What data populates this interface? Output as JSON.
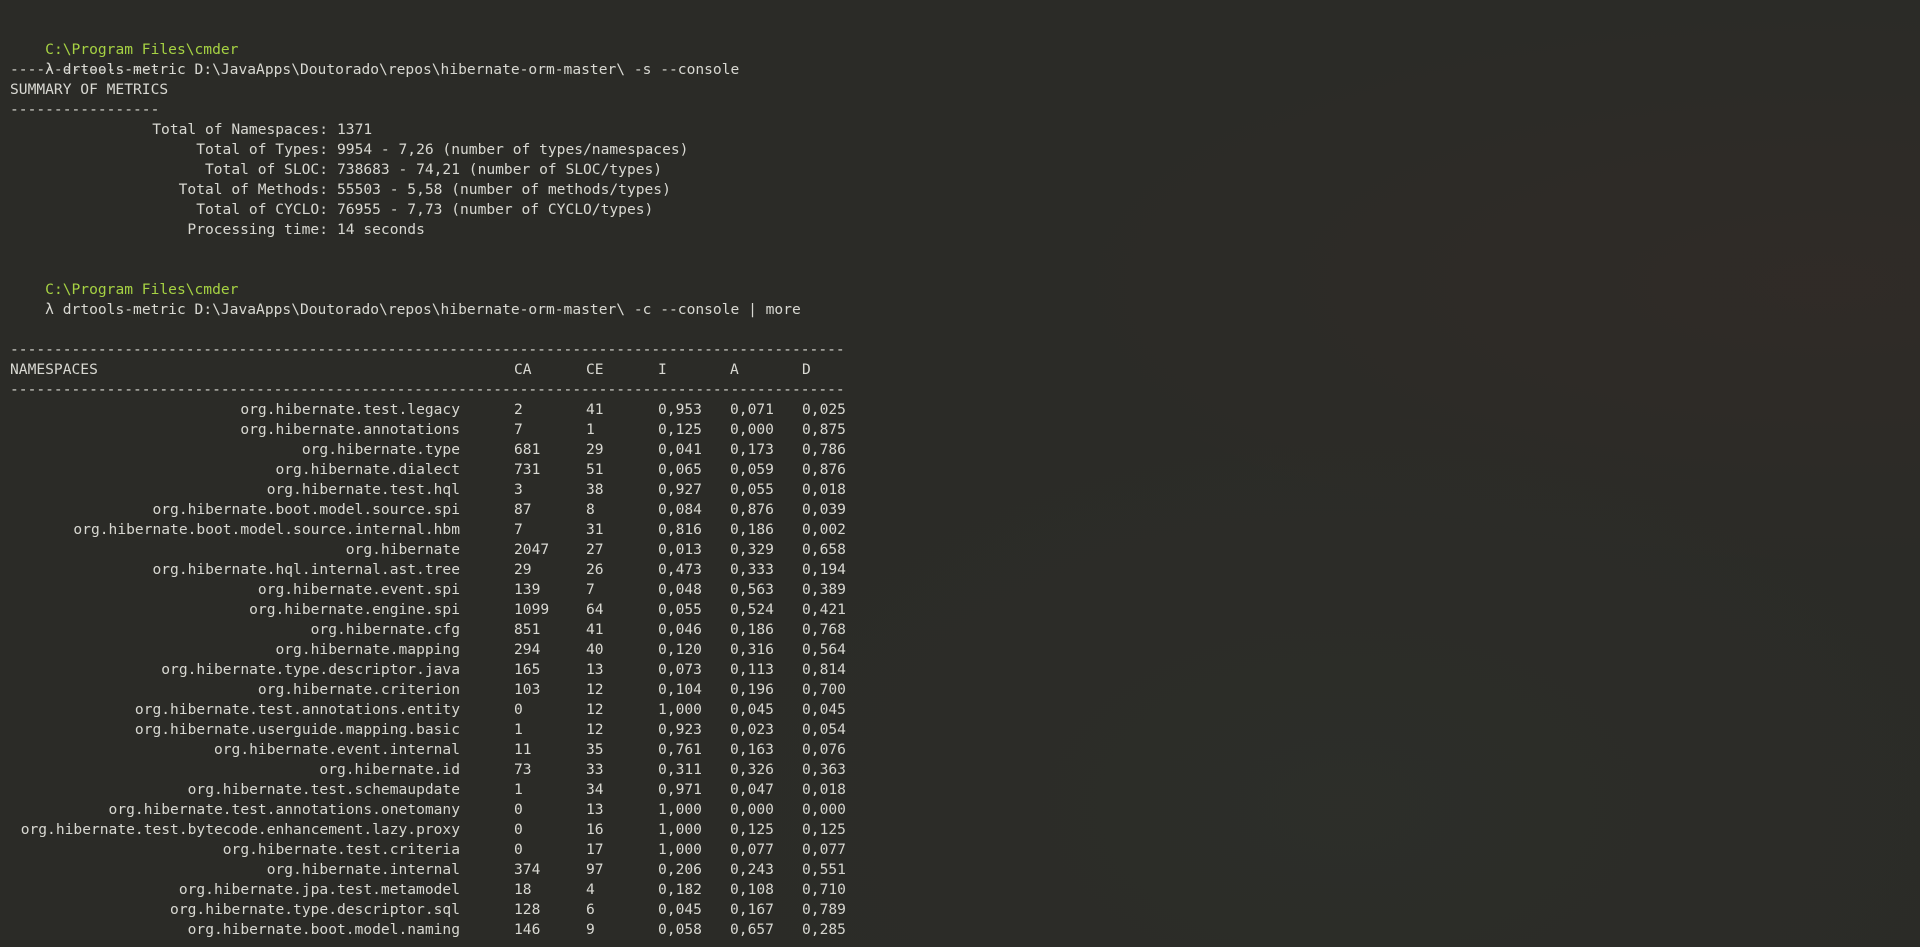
{
  "terminal": {
    "block1": {
      "prompt_path": "C:\\Program Files\\cmder",
      "lambda": "λ",
      "command": "drtools-metric D:\\JavaApps\\Doutorado\\repos\\hibernate-orm-master\\ -s --console"
    },
    "summary": {
      "separator": "-----------------",
      "title": "SUMMARY OF METRICS",
      "rows": [
        {
          "label": "Total of Namespaces:",
          "value": "1371"
        },
        {
          "label": "Total of Types:",
          "value": "9954 - 7,26 (number of types/namespaces)"
        },
        {
          "label": "Total of SLOC:",
          "value": "738683 - 74,21 (number of SLOC/types)"
        },
        {
          "label": "Total of Methods:",
          "value": "55503 - 5,58 (number of methods/types)"
        },
        {
          "label": "Total of CYCLO:",
          "value": "76955 - 7,73 (number of CYCLO/types)"
        },
        {
          "label": "Processing time:",
          "value": "14 seconds"
        }
      ]
    },
    "block2": {
      "prompt_path": "C:\\Program Files\\cmder",
      "lambda": "λ",
      "command": "drtools-metric D:\\JavaApps\\Doutorado\\repos\\hibernate-orm-master\\ -c --console | more"
    },
    "table": {
      "separator": "-----------------------------------------------------------------------------------------------",
      "headers": [
        "NAMESPACES",
        "CA",
        "CE",
        "I",
        "A",
        "D"
      ],
      "rows": [
        [
          "org.hibernate.test.legacy",
          "2",
          "41",
          "0,953",
          "0,071",
          "0,025"
        ],
        [
          "org.hibernate.annotations",
          "7",
          "1",
          "0,125",
          "0,000",
          "0,875"
        ],
        [
          "org.hibernate.type",
          "681",
          "29",
          "0,041",
          "0,173",
          "0,786"
        ],
        [
          "org.hibernate.dialect",
          "731",
          "51",
          "0,065",
          "0,059",
          "0,876"
        ],
        [
          "org.hibernate.test.hql",
          "3",
          "38",
          "0,927",
          "0,055",
          "0,018"
        ],
        [
          "org.hibernate.boot.model.source.spi",
          "87",
          "8",
          "0,084",
          "0,876",
          "0,039"
        ],
        [
          "org.hibernate.boot.model.source.internal.hbm",
          "7",
          "31",
          "0,816",
          "0,186",
          "0,002"
        ],
        [
          "org.hibernate",
          "2047",
          "27",
          "0,013",
          "0,329",
          "0,658"
        ],
        [
          "org.hibernate.hql.internal.ast.tree",
          "29",
          "26",
          "0,473",
          "0,333",
          "0,194"
        ],
        [
          "org.hibernate.event.spi",
          "139",
          "7",
          "0,048",
          "0,563",
          "0,389"
        ],
        [
          "org.hibernate.engine.spi",
          "1099",
          "64",
          "0,055",
          "0,524",
          "0,421"
        ],
        [
          "org.hibernate.cfg",
          "851",
          "41",
          "0,046",
          "0,186",
          "0,768"
        ],
        [
          "org.hibernate.mapping",
          "294",
          "40",
          "0,120",
          "0,316",
          "0,564"
        ],
        [
          "org.hibernate.type.descriptor.java",
          "165",
          "13",
          "0,073",
          "0,113",
          "0,814"
        ],
        [
          "org.hibernate.criterion",
          "103",
          "12",
          "0,104",
          "0,196",
          "0,700"
        ],
        [
          "org.hibernate.test.annotations.entity",
          "0",
          "12",
          "1,000",
          "0,045",
          "0,045"
        ],
        [
          "org.hibernate.userguide.mapping.basic",
          "1",
          "12",
          "0,923",
          "0,023",
          "0,054"
        ],
        [
          "org.hibernate.event.internal",
          "11",
          "35",
          "0,761",
          "0,163",
          "0,076"
        ],
        [
          "org.hibernate.id",
          "73",
          "33",
          "0,311",
          "0,326",
          "0,363"
        ],
        [
          "org.hibernate.test.schemaupdate",
          "1",
          "34",
          "0,971",
          "0,047",
          "0,018"
        ],
        [
          "org.hibernate.test.annotations.onetomany",
          "0",
          "13",
          "1,000",
          "0,000",
          "0,000"
        ],
        [
          "org.hibernate.test.bytecode.enhancement.lazy.proxy",
          "0",
          "16",
          "1,000",
          "0,125",
          "0,125"
        ],
        [
          "org.hibernate.test.criteria",
          "0",
          "17",
          "1,000",
          "0,077",
          "0,077"
        ],
        [
          "org.hibernate.internal",
          "374",
          "97",
          "0,206",
          "0,243",
          "0,551"
        ],
        [
          "org.hibernate.jpa.test.metamodel",
          "18",
          "4",
          "0,182",
          "0,108",
          "0,710"
        ],
        [
          "org.hibernate.type.descriptor.sql",
          "128",
          "6",
          "0,045",
          "0,167",
          "0,789"
        ],
        [
          "org.hibernate.boot.model.naming",
          "146",
          "9",
          "0,058",
          "0,657",
          "0,285"
        ]
      ]
    }
  },
  "colors": {
    "background": "#2b2b27",
    "text": "#d8d8d2",
    "prompt_path": "#a6d243"
  }
}
